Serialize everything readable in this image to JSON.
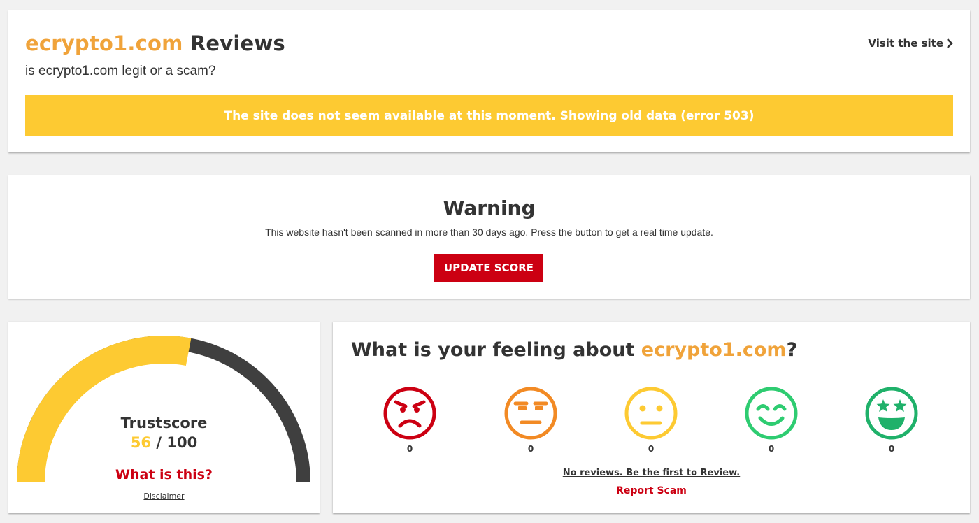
{
  "header": {
    "domain": "ecrypto1.com",
    "title_suffix": "Reviews",
    "subtitle": "is ecrypto1.com legit or a scam?",
    "visit_label": "Visit the site",
    "banner_text": "The site does not seem available at this moment. Showing old data (error 503)"
  },
  "warning": {
    "title": "Warning",
    "text": "This website hasn't been scanned in more than 30 days ago. Press the button to get a real time update.",
    "button_label": "UPDATE SCORE"
  },
  "trust": {
    "label": "Trustscore",
    "score": "56",
    "separator": " / ",
    "max": "100",
    "score_fraction": 0.56,
    "what_label": "What is this?",
    "disclaimer_label": "Disclaimer"
  },
  "feeling": {
    "title_prefix": "What is your feeling about ",
    "domain": "ecrypto1.com",
    "title_suffix": "?",
    "faces": [
      {
        "icon": "angry-face-icon",
        "count": "0",
        "color": "#cc0012"
      },
      {
        "icon": "annoyed-face-icon",
        "count": "0",
        "color": "#f28a24"
      },
      {
        "icon": "neutral-face-icon",
        "count": "0",
        "color": "#fdca32"
      },
      {
        "icon": "smiling-face-icon",
        "count": "0",
        "color": "#2ecc71"
      },
      {
        "icon": "star-eyes-face-icon",
        "count": "0",
        "color": "#1fb16a"
      }
    ],
    "no_reviews_label": "No reviews. Be the first to Review.",
    "report_label": "Report Scam"
  },
  "colors": {
    "brand_orange": "#f0a33a",
    "banner_yellow": "#fdca32",
    "alert_red": "#cc0012",
    "gauge_dark": "#3f3f3f"
  }
}
